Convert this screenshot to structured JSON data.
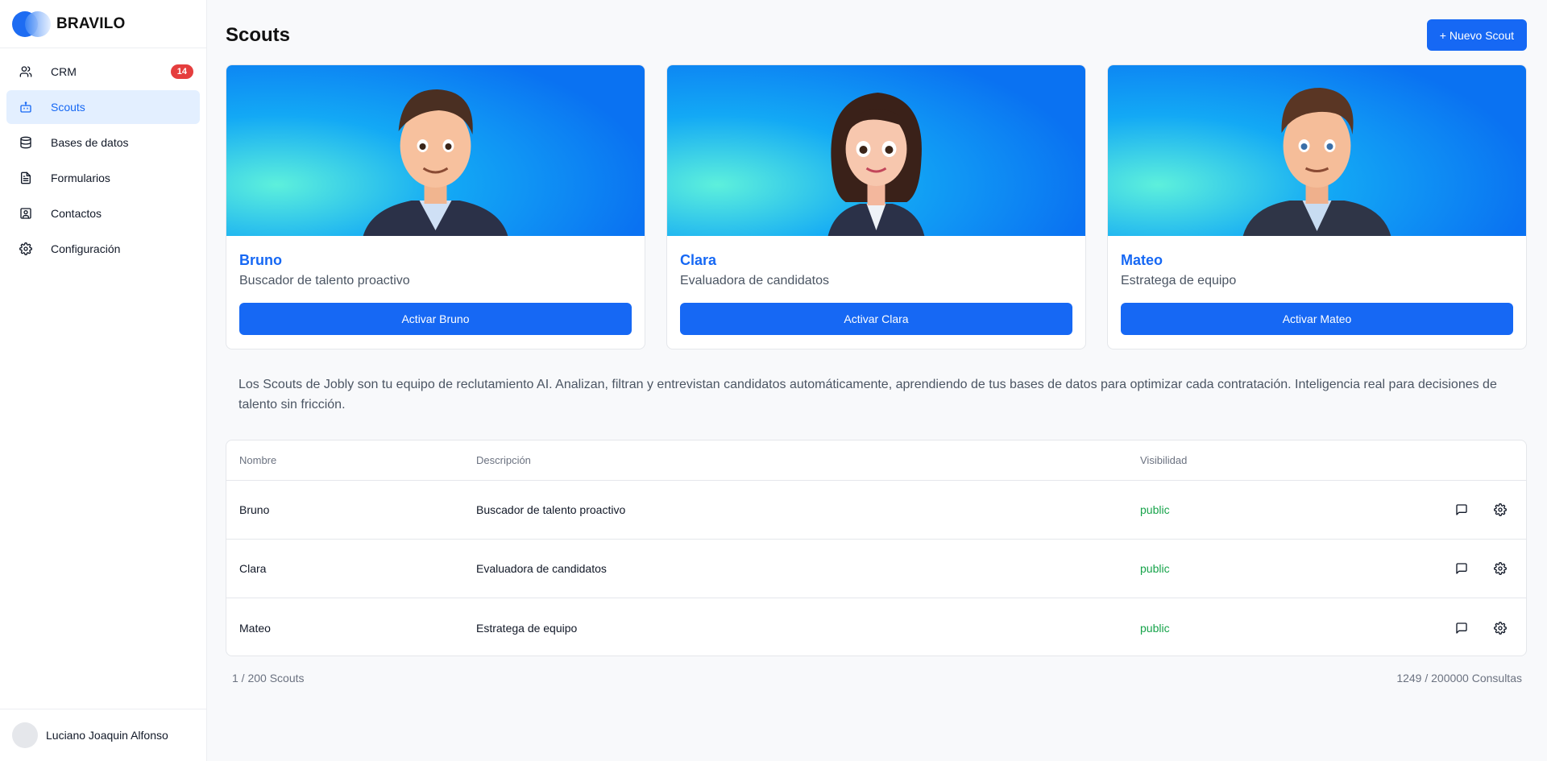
{
  "brand": {
    "name": "BRAVILO"
  },
  "sidebar": {
    "items": [
      {
        "label": "CRM",
        "icon": "users-icon",
        "badge": "14",
        "active": false
      },
      {
        "label": "Scouts",
        "icon": "bot-icon",
        "active": true
      },
      {
        "label": "Bases de datos",
        "icon": "database-icon",
        "active": false
      },
      {
        "label": "Formularios",
        "icon": "file-text-icon",
        "active": false
      },
      {
        "label": "Contactos",
        "icon": "contact-icon",
        "active": false
      },
      {
        "label": "Configuración",
        "icon": "gear-icon",
        "active": false
      }
    ]
  },
  "user": {
    "name": "Luciano Joaquin Alfonso"
  },
  "header": {
    "title": "Scouts",
    "new_button": "+ Nuevo Scout"
  },
  "cards": [
    {
      "name": "Bruno",
      "role": "Buscador de talento proactivo",
      "button": "Activar Bruno"
    },
    {
      "name": "Clara",
      "role": "Evaluadora de candidatos",
      "button": "Activar Clara"
    },
    {
      "name": "Mateo",
      "role": "Estratega de equipo",
      "button": "Activar Mateo"
    }
  ],
  "description": "Los Scouts de Jobly son tu equipo de reclutamiento AI. Analizan, filtran y entrevistan candidatos automáticamente, aprendiendo de tus bases de datos para optimizar cada contratación. Inteligencia real para decisiones de talento sin fricción.",
  "table": {
    "columns": [
      "Nombre",
      "Descripción",
      "Visibilidad"
    ],
    "rows": [
      {
        "name": "Bruno",
        "description": "Buscador de talento proactivo",
        "visibility": "public"
      },
      {
        "name": "Clara",
        "description": "Evaluadora de candidatos",
        "visibility": "public"
      },
      {
        "name": "Mateo",
        "description": "Estratega de equipo",
        "visibility": "public"
      }
    ]
  },
  "footer": {
    "scouts_count": "1 / 200 Scouts",
    "queries_count": "1249 / 200000 Consultas"
  },
  "colors": {
    "accent": "#1668f4",
    "badge": "#e53e3e",
    "public": "#16a34a"
  }
}
